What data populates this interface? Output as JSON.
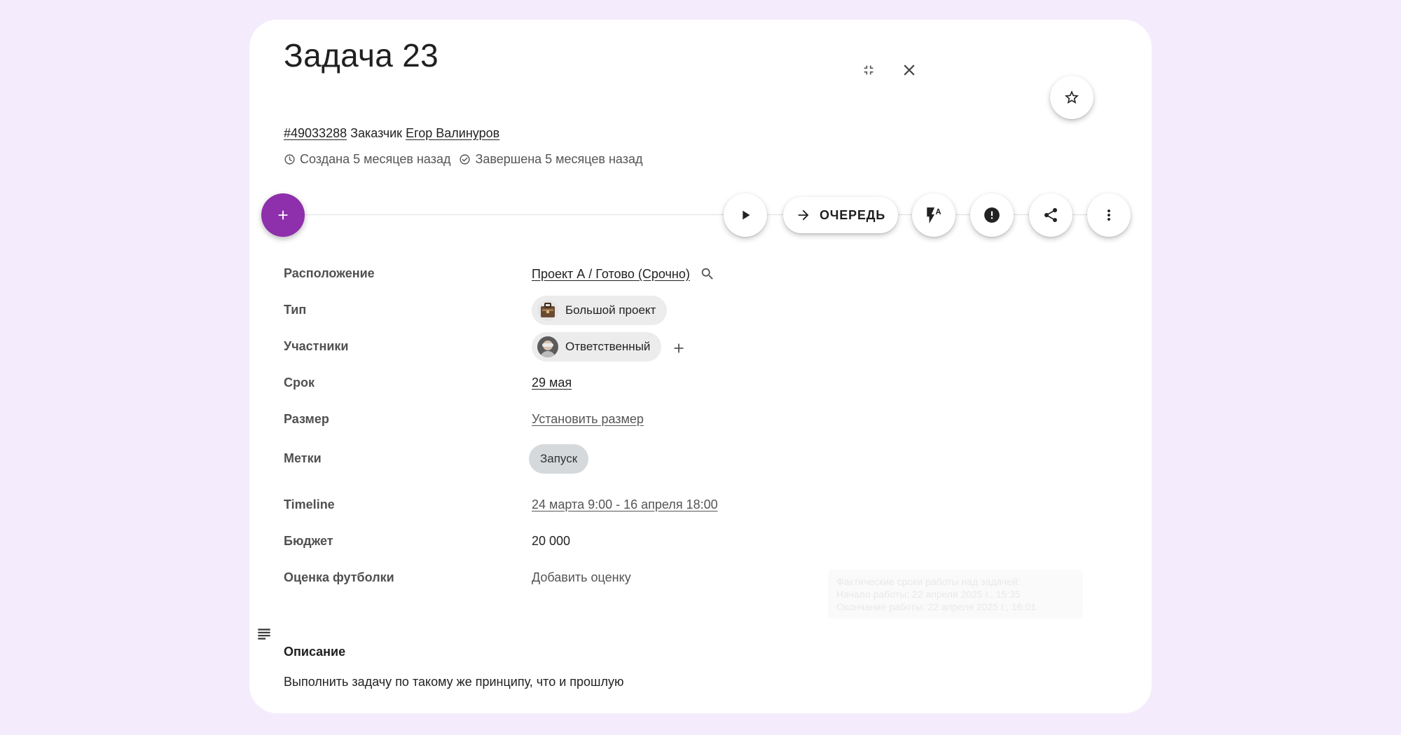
{
  "task": {
    "title": "Задача 23",
    "id_link": "#49033288",
    "customer_label": "Заказчик",
    "customer_name": "Егор Валинуров",
    "created_text": "Создана 5 месяцев назад",
    "completed_text": "Завершена 5 месяцев назад"
  },
  "header": {
    "collapse_icon": "collapse-icon",
    "close_icon": "close-icon",
    "favorite_icon": "star-icon"
  },
  "toolbar": {
    "add_icon": "plus-icon",
    "play_icon": "play-icon",
    "queue_label": "ОЧЕРЕДЬ",
    "queue_icon": "arrow-right-icon",
    "auto_icon": "flash-auto-icon",
    "priority_icon": "alert-icon",
    "share_icon": "share-icon",
    "more_icon": "more-vert-icon"
  },
  "fields": {
    "location": {
      "label": "Расположение",
      "value": "Проект А / Готово (Срочно)"
    },
    "type": {
      "label": "Тип",
      "value": "Большой проект"
    },
    "members": {
      "label": "Участники",
      "value": "Ответственный"
    },
    "deadline": {
      "label": "Срок",
      "value": "29 мая"
    },
    "size": {
      "label": "Размер",
      "value": "Установить размер"
    },
    "tags": {
      "label": "Метки",
      "value": "Запуск"
    },
    "timeline": {
      "label": "Timeline",
      "value": "24 марта 9:00 - 16 апреля 18:00"
    },
    "budget": {
      "label": "Бюджет",
      "value": "20 000"
    },
    "tshirt": {
      "label": "Оценка футболки",
      "value": "Добавить оценку"
    }
  },
  "tooltip": {
    "line1": "Фактические сроки работы над задачей:",
    "line2": "Начало работы: 22 апреля 2025 г., 15:35",
    "line3": "Окончание работы: 22 апреля 2025 г., 16:01"
  },
  "description": {
    "title": "Описание",
    "text": "Выполнить задачу по такому же принципу, что и прошлую"
  },
  "colors": {
    "background": "#f4ecfd",
    "accent": "#8e2fac",
    "tag_chip": "#d5d9dc"
  }
}
